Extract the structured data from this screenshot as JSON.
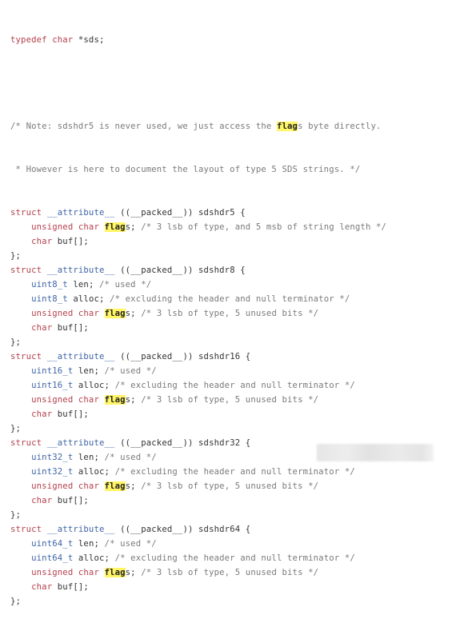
{
  "code": {
    "typedef": {
      "kw": "typedef char ",
      "rest": "*sds;"
    },
    "note1": "/* Note: sdshdr5 is never used, we just access the ",
    "note1_hl": "flag",
    "note1_tail": "s byte directly.",
    "note2": " * However is here to document the layout of type 5 SDS strings. */",
    "highlight_word": "flag",
    "structs": [
      {
        "name": "sdshdr5",
        "struct_kw": "struct",
        "attr": "__attribute__",
        "packed": " ((__packed__)) ",
        "fields": [
          {
            "type": "unsigned char",
            "name_hl": "flag",
            "name_rest": "s;",
            "comment": "/* 3 lsb of type, and 5 msb of string length */"
          },
          {
            "type": "char",
            "name_hl": "",
            "name_rest": "buf[];",
            "comment": ""
          }
        ]
      },
      {
        "name": "sdshdr8",
        "struct_kw": "struct",
        "attr": "__attribute__",
        "packed": " ((__packed__)) ",
        "fields": [
          {
            "type": "uint8_t",
            "name_hl": "",
            "name_rest": "len;",
            "comment": "/* used */"
          },
          {
            "type": "uint8_t",
            "name_hl": "",
            "name_rest": "alloc;",
            "comment": "/* excluding the header and null terminator */"
          },
          {
            "type": "unsigned char",
            "name_hl": "flag",
            "name_rest": "s;",
            "comment": "/* 3 lsb of type, 5 unused bits */"
          },
          {
            "type": "char",
            "name_hl": "",
            "name_rest": "buf[];",
            "comment": ""
          }
        ]
      },
      {
        "name": "sdshdr16",
        "struct_kw": "struct",
        "attr": "__attribute__",
        "packed": " ((__packed__)) ",
        "fields": [
          {
            "type": "uint16_t",
            "name_hl": "",
            "name_rest": "len;",
            "comment": "/* used */"
          },
          {
            "type": "uint16_t",
            "name_hl": "",
            "name_rest": "alloc;",
            "comment": "/* excluding the header and null terminator */"
          },
          {
            "type": "unsigned char",
            "name_hl": "flag",
            "name_rest": "s;",
            "comment": "/* 3 lsb of type, 5 unused bits */"
          },
          {
            "type": "char",
            "name_hl": "",
            "name_rest": "buf[];",
            "comment": ""
          }
        ]
      },
      {
        "name": "sdshdr32",
        "struct_kw": "struct",
        "attr": "__attribute__",
        "packed": " ((__packed__)) ",
        "fields": [
          {
            "type": "uint32_t",
            "name_hl": "",
            "name_rest": "len;",
            "comment": "/* used */"
          },
          {
            "type": "uint32_t",
            "name_hl": "",
            "name_rest": "alloc;",
            "comment": "/* excluding the header and null terminator */"
          },
          {
            "type": "unsigned char",
            "name_hl": "flag",
            "name_rest": "s;",
            "comment": "/* 3 lsb of type, 5 unused bits */"
          },
          {
            "type": "char",
            "name_hl": "",
            "name_rest": "buf[];",
            "comment": ""
          }
        ]
      },
      {
        "name": "sdshdr64",
        "struct_kw": "struct",
        "attr": "__attribute__",
        "packed": " ((__packed__)) ",
        "fields": [
          {
            "type": "uint64_t",
            "name_hl": "",
            "name_rest": "len;",
            "comment": "/* used */"
          },
          {
            "type": "uint64_t",
            "name_hl": "",
            "name_rest": "alloc;",
            "comment": "/* excluding the header and null terminator */"
          },
          {
            "type": "unsigned char",
            "name_hl": "flag",
            "name_rest": "s;",
            "comment": "/* 3 lsb of type, 5 unused bits */"
          },
          {
            "type": "char",
            "name_hl": "",
            "name_rest": "buf[];",
            "comment": ""
          }
        ]
      }
    ],
    "open_brace": " {",
    "close_brace": "};"
  },
  "colors": {
    "keyword": "#b5404d",
    "type": "#3f64a8",
    "comment": "#7a7a7a",
    "text": "#333333",
    "highlight": "#fff566"
  }
}
